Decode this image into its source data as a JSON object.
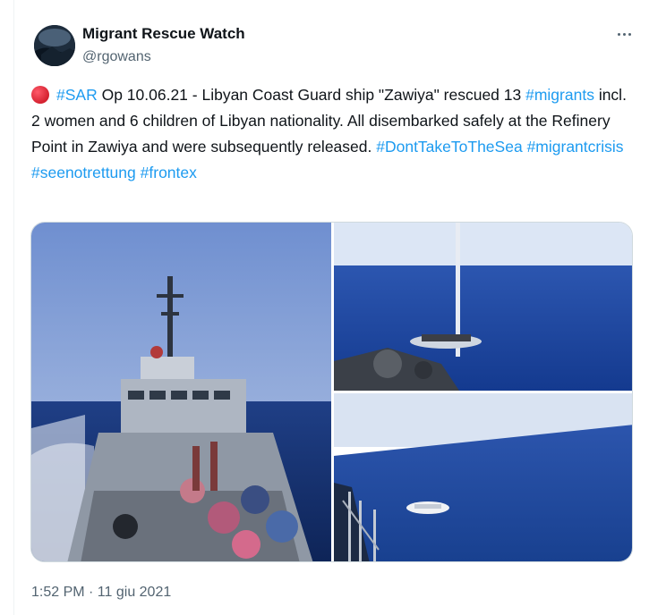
{
  "author": {
    "name": "Migrant Rescue Watch",
    "handle": "@rgowans"
  },
  "tweet": {
    "segments": [
      {
        "type": "tag",
        "text": "#SAR"
      },
      {
        "type": "text",
        "text": " Op 10.06.21 - Libyan Coast Guard ship \"Zawiya\" rescued 13 "
      },
      {
        "type": "tag",
        "text": "#migrants"
      },
      {
        "type": "text",
        "text": " incl. 2 women and 6 children of Libyan nationality. All disembarked safely at the Refinery Point in Zawiya and were subsequently released. "
      },
      {
        "type": "tag",
        "text": "#DontTakeToTheSea"
      },
      {
        "type": "text",
        "text": " "
      },
      {
        "type": "tag",
        "text": "#migrantcrisis"
      },
      {
        "type": "text",
        "text": " "
      },
      {
        "type": "tag",
        "text": "#seenotrettung"
      },
      {
        "type": "text",
        "text": " "
      },
      {
        "type": "tag",
        "text": "#frontex"
      }
    ],
    "emoji": "red-circle",
    "timestamp": "1:52 PM · 11 giu 2021"
  },
  "colors": {
    "link": "#1d9bf0",
    "text": "#0f1419",
    "secondary": "#536471",
    "emoji_red": "#d4212f"
  },
  "media": {
    "images": [
      {
        "name": "coast-guard-ship-deck-photo"
      },
      {
        "name": "rubber-boat-at-sea-photo"
      },
      {
        "name": "small-boat-distant-photo"
      }
    ]
  },
  "icons": {
    "more": "more-horizontal-icon"
  }
}
